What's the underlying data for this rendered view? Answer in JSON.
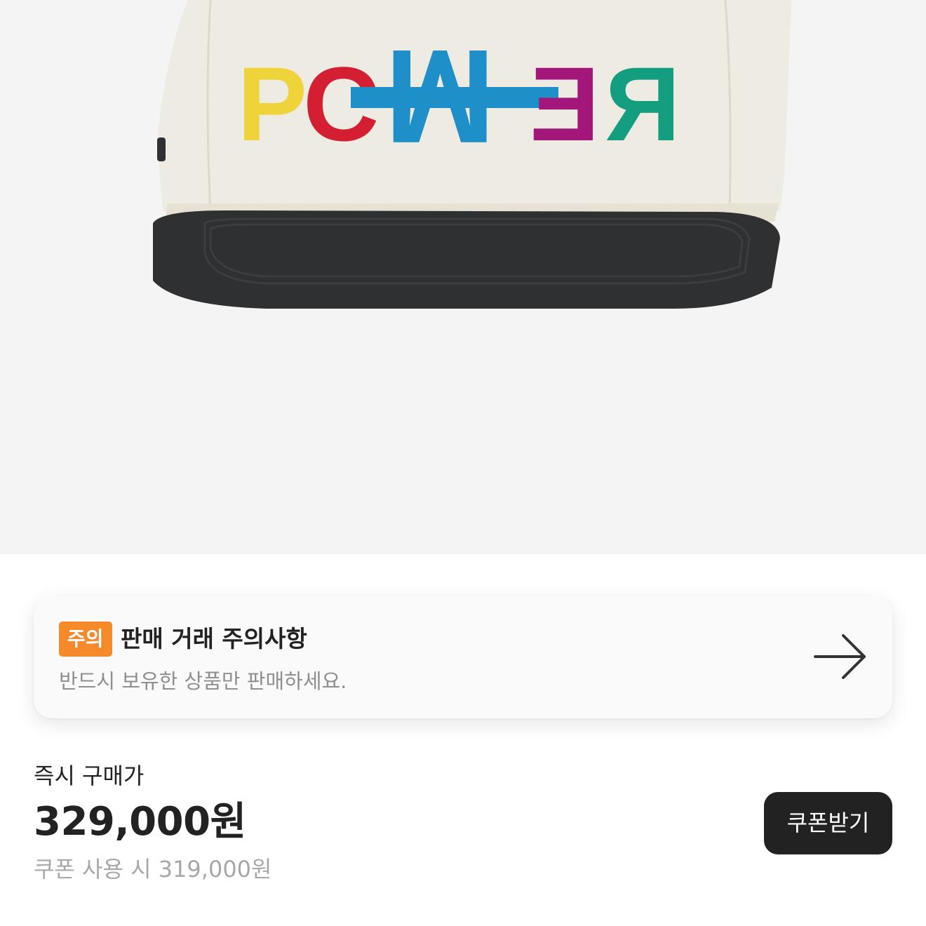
{
  "product": {
    "image_alt": "product-image",
    "logo_letters": [
      "P",
      "C",
      "W",
      "E",
      "R"
    ],
    "colors": {
      "background": "#f4f4f4",
      "cap_body": "#eeebe3",
      "cap_brim": "#2f3032",
      "letter_yellow": "#efd33a",
      "letter_red": "#d41f32",
      "letter_blue": "#1e8fc8",
      "letter_magenta": "#a3177a",
      "letter_green": "#149e80"
    }
  },
  "notice": {
    "badge": "주의",
    "title": "판매 거래 주의사항",
    "description": "반드시 보유한 상품만 판매하세요.",
    "badge_color": "#f6892a"
  },
  "price": {
    "label": "즉시 구매가",
    "amount": "329,000원",
    "coupon_text": "쿠폰 사용 시 319,000원"
  },
  "coupon_button": {
    "label": "쿠폰받기"
  }
}
